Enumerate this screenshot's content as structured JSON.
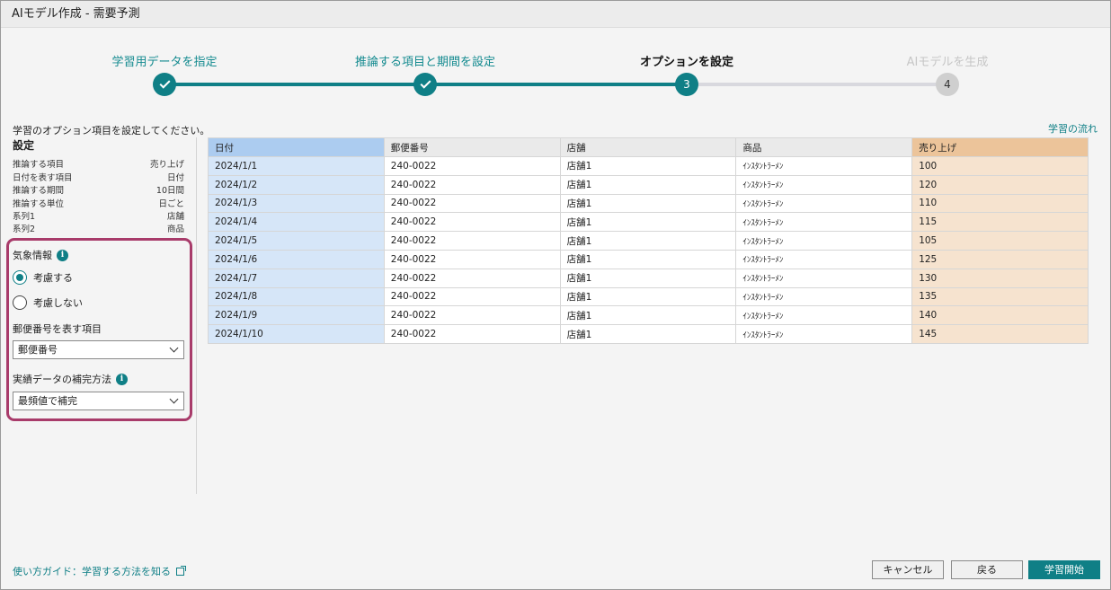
{
  "window": {
    "title": "AIモデル作成 - 需要予測"
  },
  "stepper": {
    "steps": [
      {
        "label": "学習用データを指定",
        "state": "done"
      },
      {
        "label": "推論する項目と期間を設定",
        "state": "done"
      },
      {
        "label": "オプションを設定",
        "state": "current",
        "number": "3"
      },
      {
        "label": "AIモデルを生成",
        "state": "future",
        "number": "4"
      }
    ]
  },
  "instruction": "学習のオプション項目を設定してください。",
  "flow_link": "学習の流れ",
  "settings": {
    "title": "設定",
    "items": [
      {
        "key": "推論する項目",
        "value": "売り上げ"
      },
      {
        "key": "日付を表す項目",
        "value": "日付"
      },
      {
        "key": "推論する期間",
        "value": "10日間"
      },
      {
        "key": "推論する単位",
        "value": "日ごと"
      },
      {
        "key": "系列1",
        "value": "店舗"
      },
      {
        "key": "系列2",
        "value": "商品"
      }
    ]
  },
  "weather": {
    "label": "気象情報",
    "options": [
      {
        "label": "考慮する",
        "checked": true
      },
      {
        "label": "考慮しない",
        "checked": false
      }
    ]
  },
  "postal": {
    "label": "郵便番号を表す項目",
    "value": "郵便番号"
  },
  "fill_method": {
    "label": "実績データの補完方法",
    "value": "最頻値で補完"
  },
  "table": {
    "headers": [
      "日付",
      "郵便番号",
      "店舗",
      "商品",
      "売り上げ"
    ],
    "rows": [
      [
        "2024/1/1",
        "240-0022",
        "店舗1",
        "ｲﾝｽﾀﾝﾄﾗｰﾒﾝ",
        "100"
      ],
      [
        "2024/1/2",
        "240-0022",
        "店舗1",
        "ｲﾝｽﾀﾝﾄﾗｰﾒﾝ",
        "120"
      ],
      [
        "2024/1/3",
        "240-0022",
        "店舗1",
        "ｲﾝｽﾀﾝﾄﾗｰﾒﾝ",
        "110"
      ],
      [
        "2024/1/4",
        "240-0022",
        "店舗1",
        "ｲﾝｽﾀﾝﾄﾗｰﾒﾝ",
        "115"
      ],
      [
        "2024/1/5",
        "240-0022",
        "店舗1",
        "ｲﾝｽﾀﾝﾄﾗｰﾒﾝ",
        "105"
      ],
      [
        "2024/1/6",
        "240-0022",
        "店舗1",
        "ｲﾝｽﾀﾝﾄﾗｰﾒﾝ",
        "125"
      ],
      [
        "2024/1/7",
        "240-0022",
        "店舗1",
        "ｲﾝｽﾀﾝﾄﾗｰﾒﾝ",
        "130"
      ],
      [
        "2024/1/8",
        "240-0022",
        "店舗1",
        "ｲﾝｽﾀﾝﾄﾗｰﾒﾝ",
        "135"
      ],
      [
        "2024/1/9",
        "240-0022",
        "店舗1",
        "ｲﾝｽﾀﾝﾄﾗｰﾒﾝ",
        "140"
      ],
      [
        "2024/1/10",
        "240-0022",
        "店舗1",
        "ｲﾝｽﾀﾝﾄﾗｰﾒﾝ",
        "145"
      ]
    ]
  },
  "footer": {
    "guide_link": "使い方ガイド：学習する方法を知る",
    "cancel": "キャンセル",
    "back": "戻る",
    "start": "学習開始"
  },
  "colors": {
    "accent": "#0f7f86",
    "highlight_border": "#a83b6a",
    "date_header": "#acccf0",
    "sales_header": "#ecc49a"
  },
  "icons": [
    "check-icon",
    "info-icon",
    "chevron-down-icon",
    "external-link-icon"
  ]
}
